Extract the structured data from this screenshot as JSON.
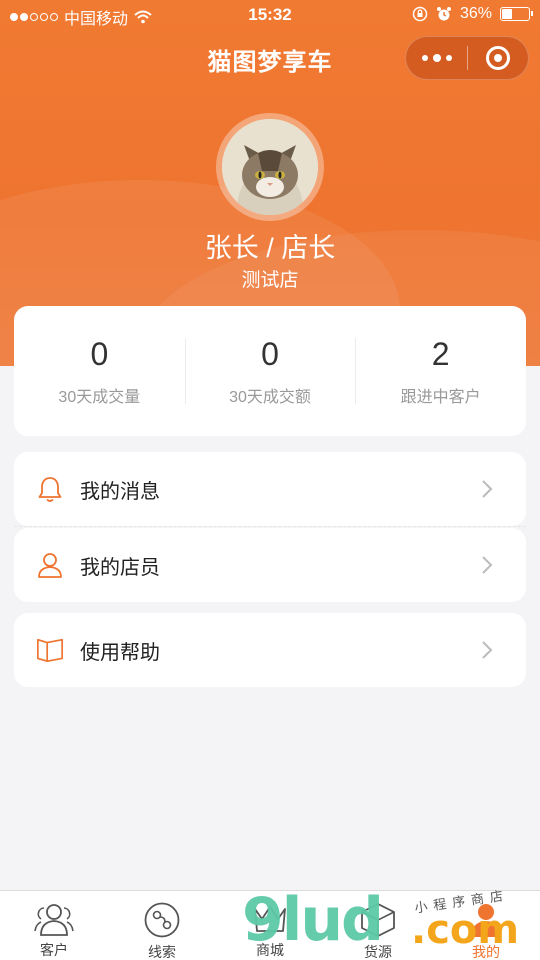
{
  "status_bar": {
    "carrier": "中国移动",
    "time": "15:32",
    "battery_percent": "36%",
    "battery_level": 0.36,
    "signal_bars_filled": 2,
    "signal_bars_total": 5
  },
  "nav": {
    "title": "猫图梦享车",
    "more_icon": "more-dots-icon",
    "close_icon": "target-circle-icon"
  },
  "profile": {
    "name": "张长",
    "role_text": " / 店长",
    "shop": "测试店"
  },
  "stats": [
    {
      "value": "0",
      "label": "30天成交量"
    },
    {
      "value": "0",
      "label": "30天成交额"
    },
    {
      "value": "2",
      "label": "跟进中客户"
    }
  ],
  "menu": [
    {
      "label": "我的消息",
      "icon": "bell-icon"
    },
    {
      "label": "我的店员",
      "icon": "person-icon"
    },
    {
      "label": "使用帮助",
      "icon": "book-icon"
    }
  ],
  "tabbar": [
    {
      "label": "客户",
      "icon": "customers-icon"
    },
    {
      "label": "线索",
      "icon": "leads-icon"
    },
    {
      "label": "商城",
      "icon": "mall-icon"
    },
    {
      "label": "货源",
      "icon": "supply-icon"
    },
    {
      "label": "我的",
      "icon": "me-icon",
      "active": true
    }
  ],
  "watermark": {
    "text": "9lud",
    "dotcom": ".com",
    "hand": "小程序商店"
  },
  "colors": {
    "brand": "#ee7430",
    "background": "#f4f4f7",
    "card": "#ffffff",
    "muted_text": "#999999"
  }
}
